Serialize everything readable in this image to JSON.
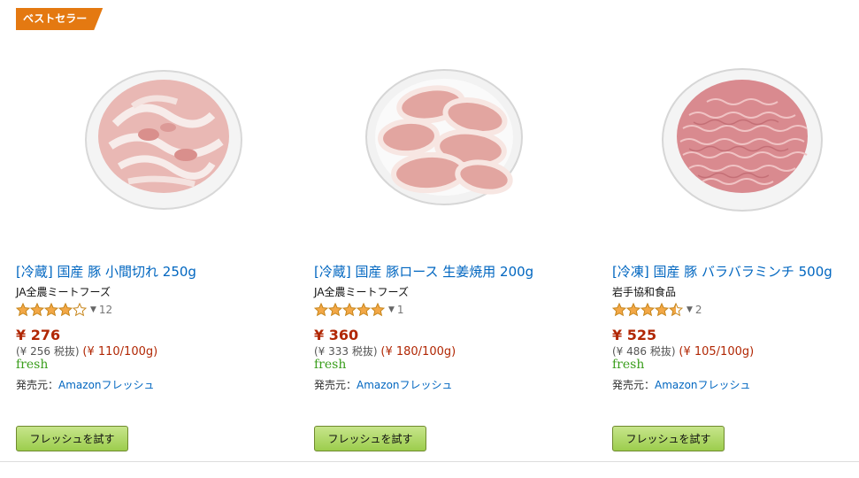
{
  "badge": "ベストセラー",
  "products": [
    {
      "title": "[冷蔵] 国産 豚 小間切れ 250g",
      "brand": "JA全農ミートフーズ",
      "rating": 4.0,
      "review_count": "12",
      "price": "¥ 276",
      "price_ex_tax": "(¥ 256 税抜)",
      "unit_price": "(¥ 110/100g)",
      "fresh_label": "fresh",
      "seller_label": "発売元：",
      "seller_name": "Amazonフレッシュ",
      "button": "フレッシュを試す"
    },
    {
      "title": "[冷蔵] 国産 豚ロース 生姜焼用 200g",
      "brand": "JA全農ミートフーズ",
      "rating": 5.0,
      "review_count": "1",
      "price": "¥ 360",
      "price_ex_tax": "(¥ 333 税抜)",
      "unit_price": "(¥ 180/100g)",
      "fresh_label": "fresh",
      "seller_label": "発売元：",
      "seller_name": "Amazonフレッシュ",
      "button": "フレッシュを試す"
    },
    {
      "title": "[冷凍] 国産 豚 バラバラミンチ 500g",
      "brand": "岩手協和食品",
      "rating": 4.5,
      "review_count": "2",
      "price": "¥ 525",
      "price_ex_tax": "(¥ 486 税抜)",
      "unit_price": "(¥ 105/100g)",
      "fresh_label": "fresh",
      "seller_label": "発売元：",
      "seller_name": "Amazonフレッシュ",
      "button": "フレッシュを試す"
    }
  ],
  "colors": {
    "link": "#0066c0",
    "price": "#b12704",
    "fresh": "#3a9e1c",
    "star": "#f3a847",
    "badge": "#e47911"
  }
}
